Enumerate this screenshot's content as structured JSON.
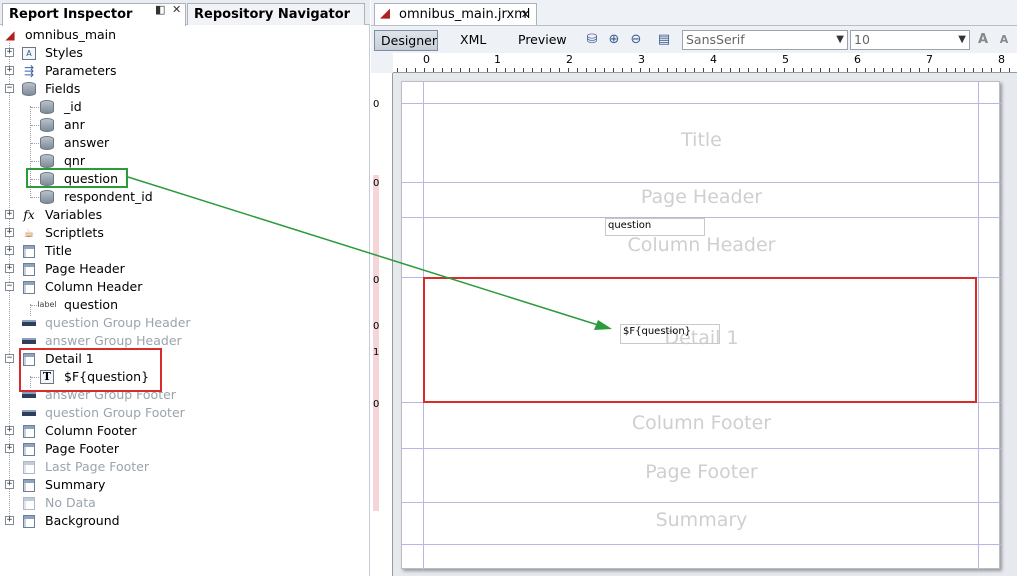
{
  "left_panel": {
    "tabs": [
      "Report Inspector",
      "Repository Navigator"
    ],
    "tree": {
      "root": "omnibus_main",
      "items": [
        {
          "label": "Styles"
        },
        {
          "label": "Parameters"
        },
        {
          "label": "Fields"
        },
        {
          "label": "_id"
        },
        {
          "label": "anr"
        },
        {
          "label": "answer"
        },
        {
          "label": "qnr"
        },
        {
          "label": "question"
        },
        {
          "label": "respondent_id"
        },
        {
          "label": "Variables"
        },
        {
          "label": "Scriptlets"
        },
        {
          "label": "Title"
        },
        {
          "label": "Page Header"
        },
        {
          "label": "Column Header"
        },
        {
          "label": "question",
          "icon_text": "label"
        },
        {
          "label": "question Group Header"
        },
        {
          "label": "answer Group Header"
        },
        {
          "label": "Detail 1"
        },
        {
          "label": "$F{question}"
        },
        {
          "label": "answer Group Footer"
        },
        {
          "label": "question Group Footer"
        },
        {
          "label": "Column Footer"
        },
        {
          "label": "Page Footer"
        },
        {
          "label": "Last Page Footer"
        },
        {
          "label": "Summary"
        },
        {
          "label": "No Data"
        },
        {
          "label": "Background"
        }
      ]
    }
  },
  "editor": {
    "doc_tab": "omnibus_main.jrxml",
    "mode_buttons": [
      "Designer",
      "XML",
      "Preview"
    ],
    "font_family": "SansSerif",
    "font_size": "10",
    "ruler_numbers": [
      "0",
      "1",
      "2",
      "3",
      "4",
      "5",
      "6",
      "7",
      "8"
    ],
    "vruler_numbers": [
      "0",
      "0",
      "0",
      "0",
      "1",
      "0"
    ],
    "bands": [
      "Title",
      "Page Header",
      "Column Header",
      "Detail 1",
      "Column Footer",
      "Page Footer",
      "Summary"
    ],
    "fields": {
      "column_header_label": "question",
      "detail_text_field": "$F{question}"
    }
  },
  "colors": {
    "annotation_red": "#d92b2b",
    "annotation_green": "#2c9b3a",
    "guide_lines": "#b7b7e6"
  }
}
